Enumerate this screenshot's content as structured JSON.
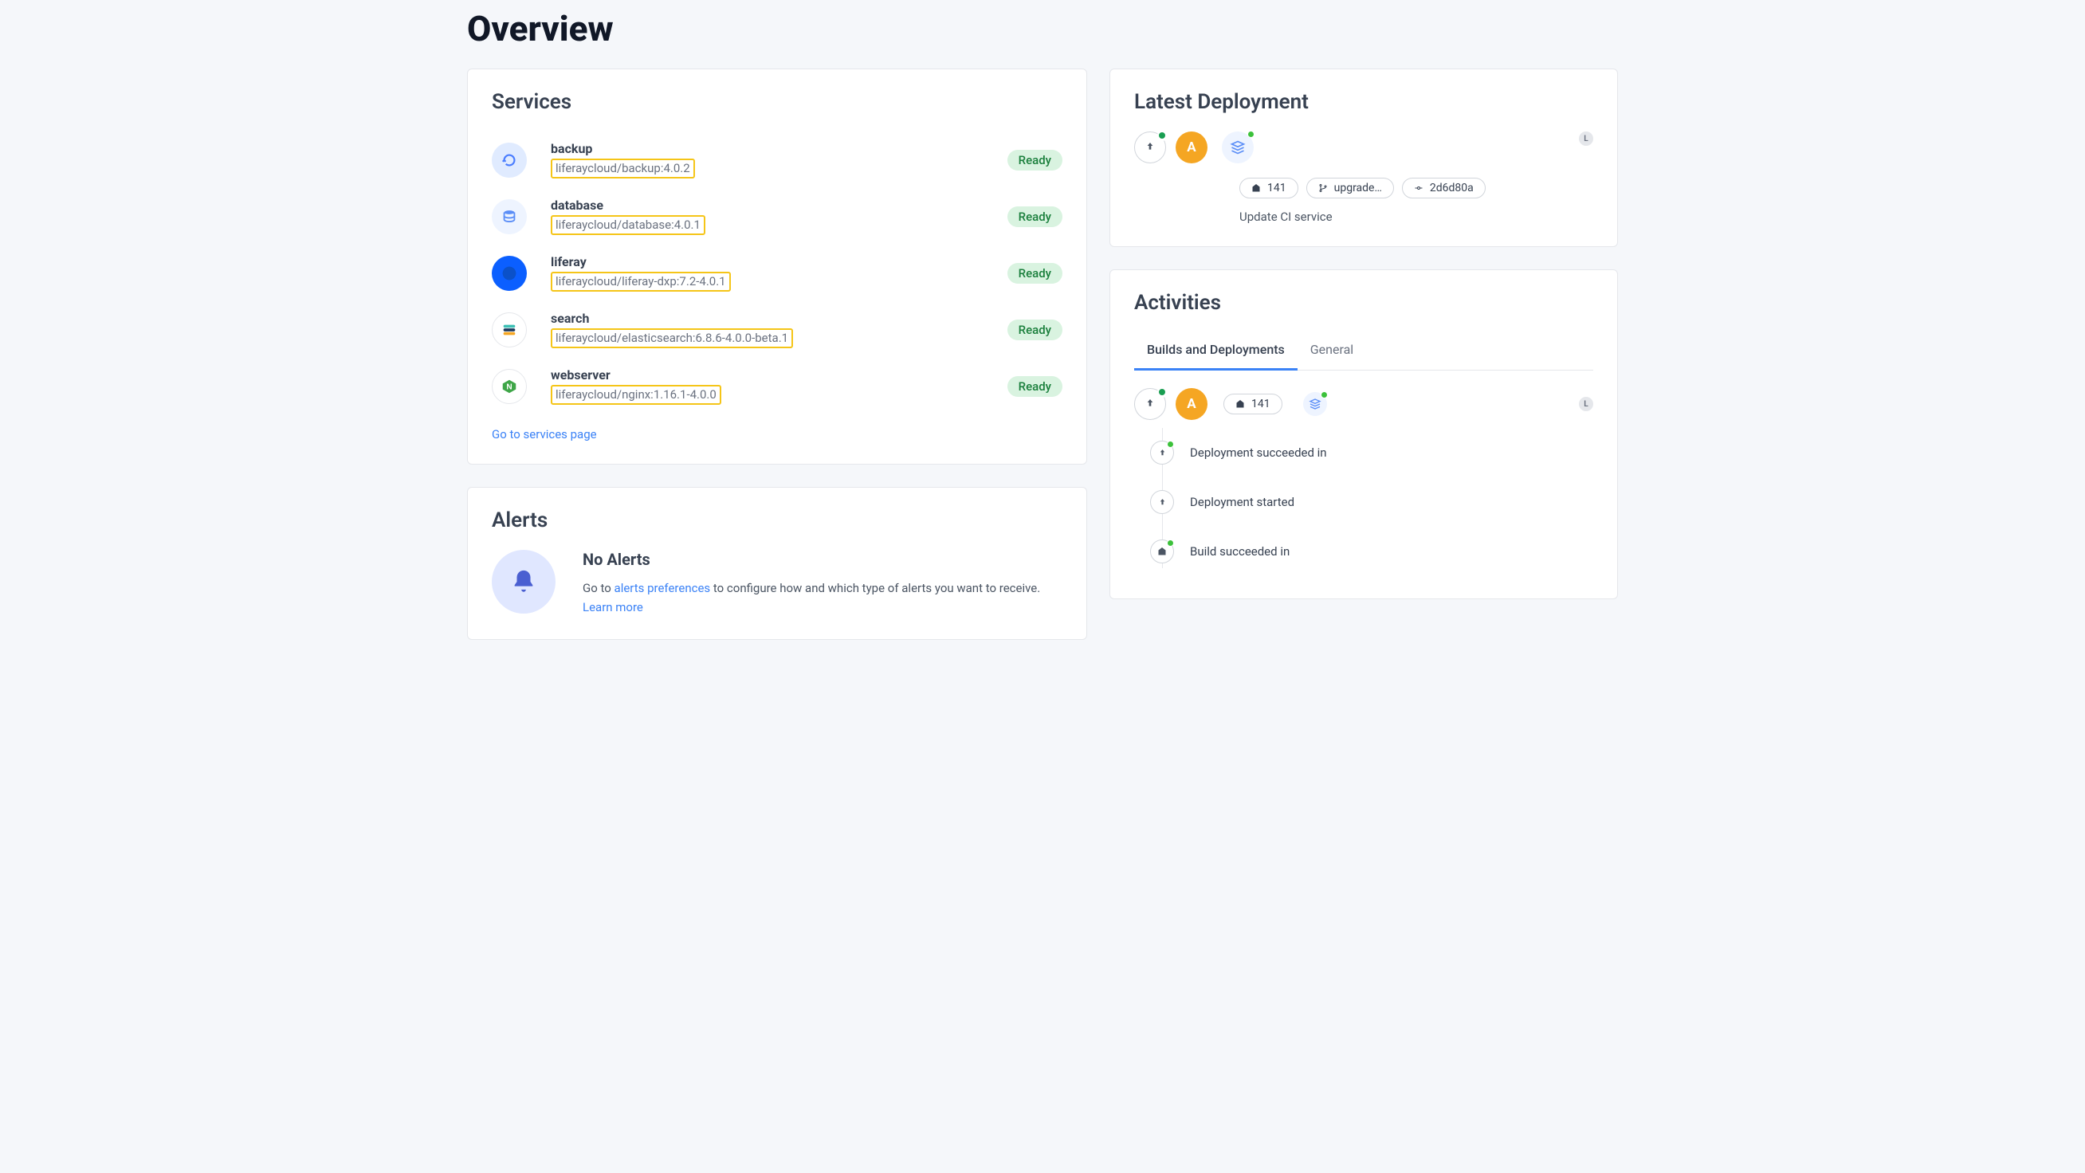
{
  "page_title": "Overview",
  "services": {
    "title": "Services",
    "items": [
      {
        "name": "backup",
        "image": "liferaycloud/backup:4.0.2",
        "status": "Ready",
        "icon": "backup"
      },
      {
        "name": "database",
        "image": "liferaycloud/database:4.0.1",
        "status": "Ready",
        "icon": "database"
      },
      {
        "name": "liferay",
        "image": "liferaycloud/liferay-dxp:7.2-4.0.1",
        "status": "Ready",
        "icon": "liferay"
      },
      {
        "name": "search",
        "image": "liferaycloud/elasticsearch:6.8.6-4.0.0-beta.1",
        "status": "Ready",
        "icon": "search"
      },
      {
        "name": "webserver",
        "image": "liferaycloud/nginx:1.16.1-4.0.0",
        "status": "Ready",
        "icon": "webserver"
      }
    ],
    "link_text": "Go to services page"
  },
  "alerts": {
    "title": "Alerts",
    "heading": "No Alerts",
    "text_pre": "Go to ",
    "link1": "alerts preferences",
    "text_mid": " to configure how and which type of alerts you want to receive. ",
    "link2": "Learn more"
  },
  "latest_deployment": {
    "title": "Latest Deployment",
    "avatar_letter": "A",
    "pills": {
      "build_number": "141",
      "branch": "upgrade…",
      "commit": "2d6d80a"
    },
    "message": "Update CI service"
  },
  "activities": {
    "title": "Activities",
    "tabs": {
      "builds": "Builds and Deployments",
      "general": "General"
    },
    "header": {
      "avatar_letter": "A",
      "build_number": "141"
    },
    "items": [
      {
        "text": "Deployment succeeded in",
        "icon": "upload"
      },
      {
        "text": "Deployment started",
        "icon": "upload"
      },
      {
        "text": "Build succeeded in",
        "icon": "pin"
      }
    ]
  }
}
